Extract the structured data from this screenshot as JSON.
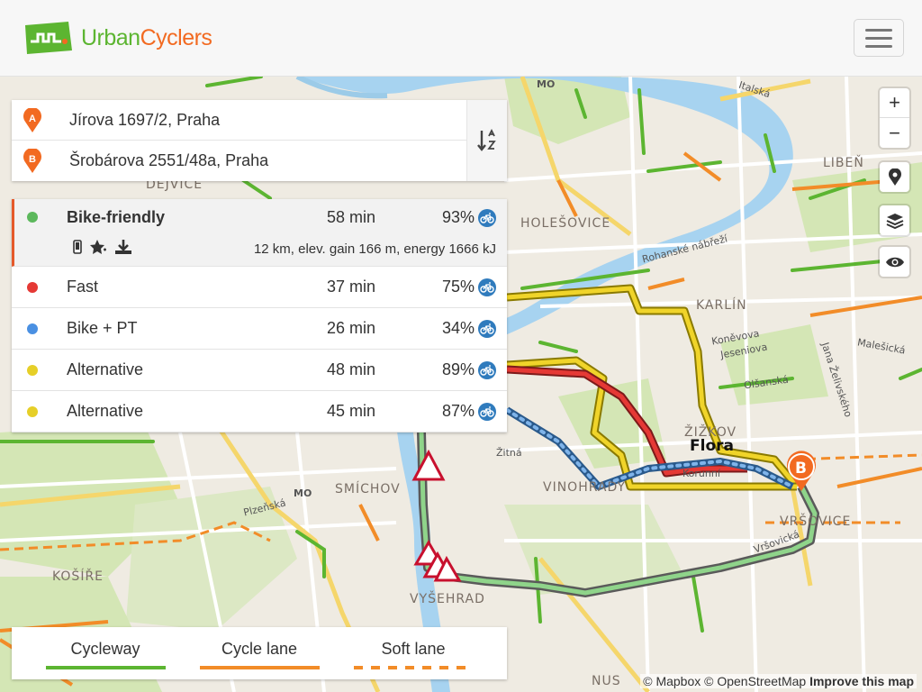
{
  "header": {
    "logo_urban": "Urban",
    "logo_cyclers": "Cyclers",
    "menu_icon": "hamburger-menu-icon"
  },
  "search": {
    "origin_marker": "A",
    "origin_value": "Jírova 1697/2, Praha",
    "destination_marker": "B",
    "destination_value": "Šrobárova 2551/48a, Praha",
    "swap_icon": "swap-sort-icon"
  },
  "routes": [
    {
      "name": "Bike-friendly",
      "time": "58 min",
      "percent": "93%",
      "color": "#5cb85c",
      "selected": true,
      "details": "12 km, elev. gain 166 m, energy 1666 kJ"
    },
    {
      "name": "Fast",
      "time": "37 min",
      "percent": "75%",
      "color": "#e53935",
      "selected": false
    },
    {
      "name": "Bike + PT",
      "time": "26 min",
      "percent": "34%",
      "color": "#4a90e2",
      "selected": false
    },
    {
      "name": "Alternative",
      "time": "48 min",
      "percent": "89%",
      "color": "#e6cf28",
      "selected": false
    },
    {
      "name": "Alternative",
      "time": "45 min",
      "percent": "87%",
      "color": "#e6cf28",
      "selected": false
    }
  ],
  "route_action_icons": [
    "phone-icon",
    "star-icon",
    "download-icon"
  ],
  "legend": {
    "cycleway": "Cycleway",
    "cycle_lane": "Cycle lane",
    "soft_lane": "Soft lane",
    "cycleway_color": "#5cb531",
    "cycle_lane_color": "#f28c28"
  },
  "map_controls": {
    "zoom_in": "+",
    "zoom_out": "−",
    "locate_icon": "location-pin-icon",
    "layers_icon": "layers-icon",
    "visibility_icon": "eye-icon"
  },
  "map_labels": {
    "libeň": "LIBEŇ",
    "holesovice": "HOLEŠOVICE",
    "karlin": "KARLÍN",
    "zizkov": "ŽIŽKOV",
    "flora": "Flora",
    "smichov": "SMÍCHOV",
    "vinohrady": "VINOHRADY",
    "vrsovice": "VRŠOVICE",
    "kosire": "KOŠÍŘE",
    "vysehrad": "VYŠEHRAD",
    "dejvice": "DEJVICE",
    "nusle": "NUS",
    "rohanske": "Rohanské nábřeží",
    "konevova": "Koněvova",
    "jeseniova": "Jeseniova",
    "olsanska": "Olšanská",
    "zelivskeho": "Jana Želivského",
    "malesicka": "Malešická",
    "zitna": "Žitná",
    "plzenska": "Plzeňská",
    "vrsovicka": "Vršovická",
    "koruni": "Korunní",
    "italska": "Italská",
    "mo1": "MO",
    "mo2": "MO",
    "destination_marker": "B"
  },
  "attribution": {
    "mapbox": "© Mapbox",
    "osm": "© OpenStreetMap",
    "improve": "Improve this map"
  }
}
